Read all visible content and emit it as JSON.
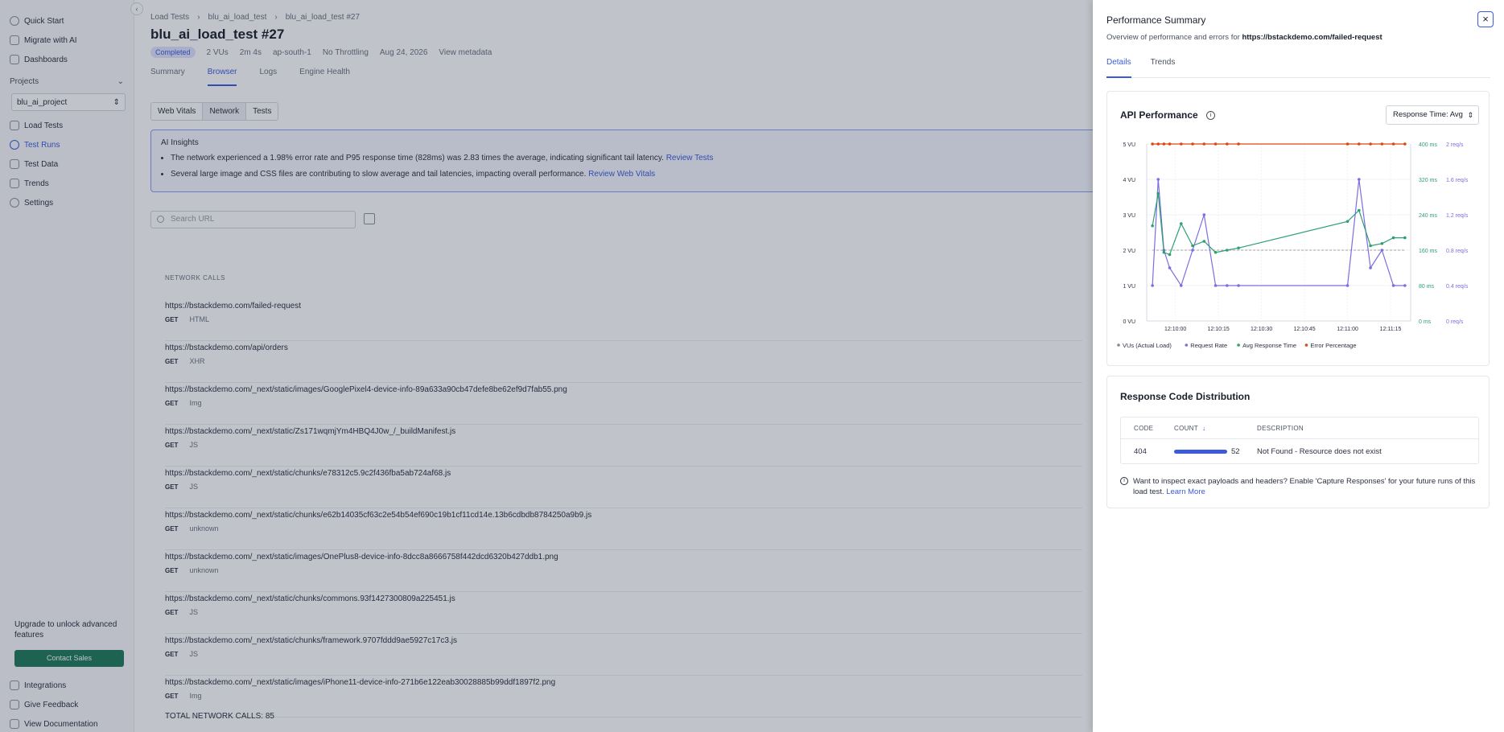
{
  "sidebar": {
    "top_items": [
      {
        "label": "Quick Start",
        "icon": "check-circle-icon"
      },
      {
        "label": "Migrate with AI",
        "icon": "sparkle-icon"
      },
      {
        "label": "Dashboards",
        "icon": "grid-icon"
      }
    ],
    "projects_label": "Projects",
    "project_value": "blu_ai_project",
    "items": [
      {
        "label": "Load Tests",
        "icon": "list-icon"
      },
      {
        "label": "Test Runs",
        "icon": "clock-icon",
        "active": true
      },
      {
        "label": "Test Data",
        "icon": "table-icon"
      },
      {
        "label": "Trends",
        "icon": "trend-icon"
      },
      {
        "label": "Settings",
        "icon": "gear-icon"
      }
    ],
    "upgrade_text": "Upgrade to unlock advanced features",
    "contact_label": "Contact Sales",
    "bottom_items": [
      {
        "label": "Integrations",
        "icon": "plug-icon"
      },
      {
        "label": "Give Feedback",
        "icon": "feedback-icon"
      },
      {
        "label": "View Documentation",
        "icon": "doc-icon"
      }
    ]
  },
  "main": {
    "breadcrumb": [
      "Load Tests",
      "blu_ai_load_test",
      "blu_ai_load_test #27"
    ],
    "title": "blu_ai_load_test #27",
    "status": "Completed",
    "vus": "2 VUs",
    "duration": "2m 4s",
    "region": "ap-south-1",
    "throttling": "No Throttling",
    "date": "Aug 24, 2026",
    "view_metadata": "View metadata",
    "tabs": [
      "Summary",
      "Browser",
      "Logs",
      "Engine Health"
    ],
    "segments": [
      "Web Vitals",
      "Network",
      "Tests"
    ],
    "insights_title": "AI Insights",
    "insight1": "The network experienced a 1.98% error rate and P95 response time (828ms) was 2.83 times the average, indicating significant tail latency.",
    "insight1_link": "Review Tests",
    "insight2": "Several large image and CSS files are contributing to slow average and tail latencies, impacting overall performance.",
    "insight2_link": "Review Web Vitals",
    "search_placeholder": "Search URL",
    "network_label": "NETWORK CALLS",
    "network_calls": [
      {
        "url": "https://bstackdemo.com/failed-request",
        "method": "GET",
        "type": "HTML"
      },
      {
        "url": "https://bstackdemo.com/api/orders",
        "method": "GET",
        "type": "XHR"
      },
      {
        "url": "https://bstackdemo.com/_next/static/images/GooglePixel4-device-info-89a633a90cb47defe8be62ef9d7fab55.png",
        "method": "GET",
        "type": "Img"
      },
      {
        "url": "https://bstackdemo.com/_next/static/Zs171wqmjYm4HBQ4J0w_/_buildManifest.js",
        "method": "GET",
        "type": "JS"
      },
      {
        "url": "https://bstackdemo.com/_next/static/chunks/e78312c5.9c2f436fba5ab724af68.js",
        "method": "GET",
        "type": "JS"
      },
      {
        "url": "https://bstackdemo.com/_next/static/chunks/e62b14035cf63c2e54b54ef690c19b1cf11cd14e.13b6cdbdb8784250a9b9.js",
        "method": "GET",
        "type": "unknown"
      },
      {
        "url": "https://bstackdemo.com/_next/static/images/OnePlus8-device-info-8dcc8a8666758f442dcd6320b427ddb1.png",
        "method": "GET",
        "type": "unknown"
      },
      {
        "url": "https://bstackdemo.com/_next/static/chunks/commons.93f1427300809a225451.js",
        "method": "GET",
        "type": "JS"
      },
      {
        "url": "https://bstackdemo.com/_next/static/chunks/framework.9707fddd9ae5927c17c3.js",
        "method": "GET",
        "type": "JS"
      },
      {
        "url": "https://bstackdemo.com/_next/static/images/iPhone11-device-info-271b6e122eab30028885b99ddf1897f2.png",
        "method": "GET",
        "type": "Img"
      }
    ],
    "total_calls": "TOTAL NETWORK CALLS: 85"
  },
  "drawer": {
    "title": "Performance Summary",
    "subtitle_prefix": "Overview of performance and errors for ",
    "subtitle_url": "https://bstackdemo.com/failed-request",
    "close_label": "×",
    "tabs": [
      "Details",
      "Trends"
    ],
    "api_title": "API Performance",
    "response_select": "Response Time: Avg",
    "response_title": "Response Code Distribution",
    "table_headers": [
      "CODE",
      "COUNT",
      "DESCRIPTION"
    ],
    "table_rows": [
      {
        "code": "404",
        "count": "52",
        "description": "Not Found - Resource does not exist"
      }
    ],
    "hint_text": "Want to inspect exact payloads and headers? Enable 'Capture Responses' for your future runs of this load test.",
    "hint_link": "Learn More"
  },
  "chart_data": {
    "type": "line",
    "x": [
      "12:09:52",
      "12:09:54",
      "12:09:56",
      "12:09:58",
      "12:10:02",
      "12:10:06",
      "12:10:10",
      "12:10:14",
      "12:10:18",
      "12:10:22",
      "12:11:00",
      "12:11:04",
      "12:11:08",
      "12:11:12",
      "12:11:16",
      "12:11:20"
    ],
    "x_ticks": [
      "12:10:00",
      "12:10:15",
      "12:10:30",
      "12:10:45",
      "12:11:00",
      "12:11:15"
    ],
    "y_left_ticks": [
      "0 VU",
      "1 VU",
      "2 VU",
      "3 VU",
      "4 VU",
      "5 VU"
    ],
    "y_mid_ticks": [
      "0 ms",
      "80 ms",
      "160 ms",
      "240 ms",
      "320 ms",
      "400 ms"
    ],
    "y_right_ticks": [
      "0 req/s",
      "0.4 req/s",
      "0.8 req/s",
      "1.2 req/s",
      "1.6 req/s",
      "2 req/s"
    ],
    "ylim_vu": [
      0,
      5
    ],
    "ylim_ms": [
      0,
      400
    ],
    "ylim_rps": [
      0,
      2
    ],
    "series": [
      {
        "name": "VUs (Actual Load)",
        "color": "#888888",
        "axis": "vu",
        "values": [
          2,
          2,
          2,
          2,
          2,
          2,
          2,
          2,
          2,
          2,
          2,
          2,
          2,
          2,
          2,
          2
        ]
      },
      {
        "name": "Request Rate",
        "color": "#7b6ee0",
        "axis": "rps",
        "values": [
          0.4,
          1.6,
          0.8,
          0.6,
          0.4,
          0.8,
          1.2,
          0.4,
          0.4,
          0.4,
          0.4,
          1.6,
          0.6,
          0.8,
          0.4,
          0.4
        ]
      },
      {
        "name": "Avg Response Time",
        "color": "#2f9e72",
        "axis": "ms",
        "values": [
          215,
          288,
          155,
          150,
          220,
          170,
          180,
          155,
          160,
          165,
          225,
          250,
          170,
          175,
          188,
          188
        ]
      },
      {
        "name": "Error Percentage",
        "color": "#d9480f",
        "axis": "vu",
        "values": [
          5,
          5,
          5,
          5,
          5,
          5,
          5,
          5,
          5,
          5,
          5,
          5,
          5,
          5,
          5,
          5
        ]
      }
    ],
    "legend_position": "bottom"
  }
}
